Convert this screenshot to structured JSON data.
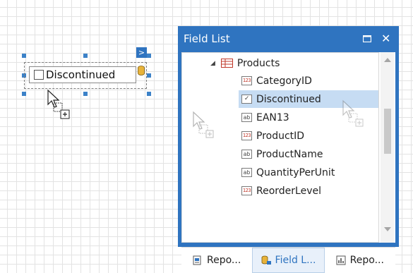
{
  "design_surface": {
    "control_label": "Discontinued",
    "smart_tag_glyph": ">"
  },
  "field_list": {
    "title": "Field List",
    "maximize_glyph": "□",
    "close_glyph": "✕",
    "tree": {
      "expander_glyph": "◢",
      "root": "Products",
      "fields": [
        {
          "name": "CategoryID",
          "type": "123"
        },
        {
          "name": "Discontinued",
          "type": "check"
        },
        {
          "name": "EAN13",
          "type": "ab"
        },
        {
          "name": "ProductID",
          "type": "123"
        },
        {
          "name": "ProductName",
          "type": "ab"
        },
        {
          "name": "QuantityPerUnit",
          "type": "ab"
        },
        {
          "name": "ReorderLevel",
          "type": "123"
        }
      ],
      "selected": "Discontinued"
    },
    "tabs": [
      {
        "label": "Repo...",
        "icon": "report-explorer-icon"
      },
      {
        "label": "Field L...",
        "icon": "field-list-icon",
        "active": true
      },
      {
        "label": "Repo...",
        "icon": "report-gallery-icon"
      }
    ],
    "accent_color": "#2f74c0"
  }
}
